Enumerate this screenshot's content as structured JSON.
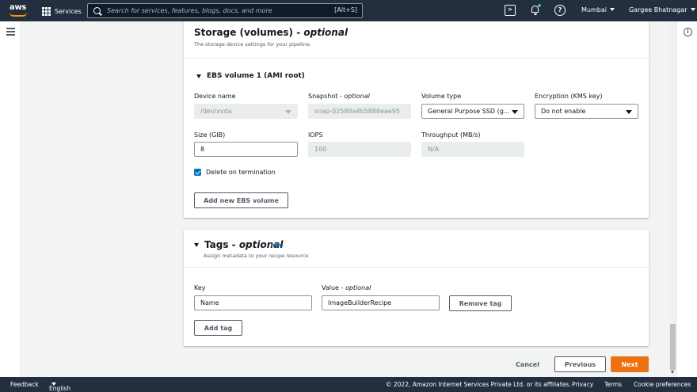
{
  "topnav": {
    "logo_text": "aws",
    "services_label": "Services",
    "search_placeholder": "Search for services, features, blogs, docs, and more",
    "search_shortcut": "[Alt+S]",
    "region": "Mumbai",
    "user": "Gargee Bhatnagar"
  },
  "storage": {
    "title": "Storage (volumes)",
    "title_optional": "optional",
    "description": "The storage device settings for your pipeline.",
    "volume_title": "EBS volume 1 (AMI root)",
    "device_name_label": "Device name",
    "device_name_value": "/dev/xvda",
    "snapshot_label": "Snapshot",
    "snapshot_optional": "optional",
    "snapshot_value": "snap-02588a4b5888eae95",
    "volume_type_label": "Volume type",
    "volume_type_value": "General Purpose SSD (g...",
    "encryption_label": "Encryption (KMS key)",
    "encryption_value": "Do not enable",
    "size_label": "Size (GIB)",
    "size_value": "8",
    "iops_label": "IOPS",
    "iops_value": "100",
    "throughput_label": "Throughput (MB/s)",
    "throughput_value": "N/A",
    "delete_label": "Delete on termination",
    "add_volume_button": "Add new EBS volume"
  },
  "tags": {
    "title": "Tags",
    "title_optional": "optional",
    "info_label": "Info",
    "description": "Assign metadata to your recipe resource.",
    "key_label": "Key",
    "value_label": "Value",
    "value_optional": "optional",
    "key_value": "Name",
    "value_value": "ImageBuilderRecipe",
    "remove_button": "Remove tag",
    "add_button": "Add tag"
  },
  "actions": {
    "cancel": "Cancel",
    "previous": "Previous",
    "next": "Next"
  },
  "footer": {
    "feedback": "Feedback",
    "language": "English (US)",
    "copyright": "© 2022, Amazon Internet Services Private Ltd. or its affiliates.",
    "privacy": "Privacy",
    "terms": "Terms",
    "cookies": "Cookie preferences"
  },
  "colors": {
    "nav_bg": "#232f3e",
    "primary": "#ec7211",
    "link": "#0073bb",
    "accent": "#ff9900"
  }
}
